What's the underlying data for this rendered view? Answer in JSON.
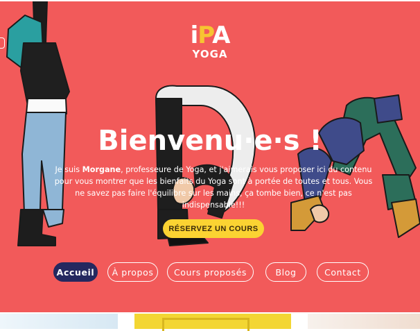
{
  "logo": {
    "mark_i": "i",
    "mark_p": "P",
    "mark_a": "A",
    "word": "YOGA"
  },
  "hero": {
    "title": "Bienvenu·e·s !",
    "intro_before": "Je suis ",
    "intro_name": "Morgane",
    "intro_after": ", professeure de Yoga, et j'aimerais vous proposer ici du contenu pour vous montrer que les bienfaits du Yoga sont à portée de toutes et tous. Vous ne savez pas faire l'équilibre sur les mains, ça tombe bien, ce n'est pas indispensable!!!",
    "cta_label": "RÉSERVEZ UN COURS"
  },
  "nav": {
    "items": [
      {
        "label": "Accueil",
        "active": true
      },
      {
        "label": "À propos",
        "active": false
      },
      {
        "label": "Cours proposés",
        "active": false
      },
      {
        "label": "Blog",
        "active": false
      },
      {
        "label": "Contact",
        "active": false
      }
    ]
  },
  "colors": {
    "hero_bg": "#f25a5a",
    "cta_bg": "#fbd332",
    "nav_active_bg": "#24285f",
    "logo_accent": "#f7c431"
  }
}
